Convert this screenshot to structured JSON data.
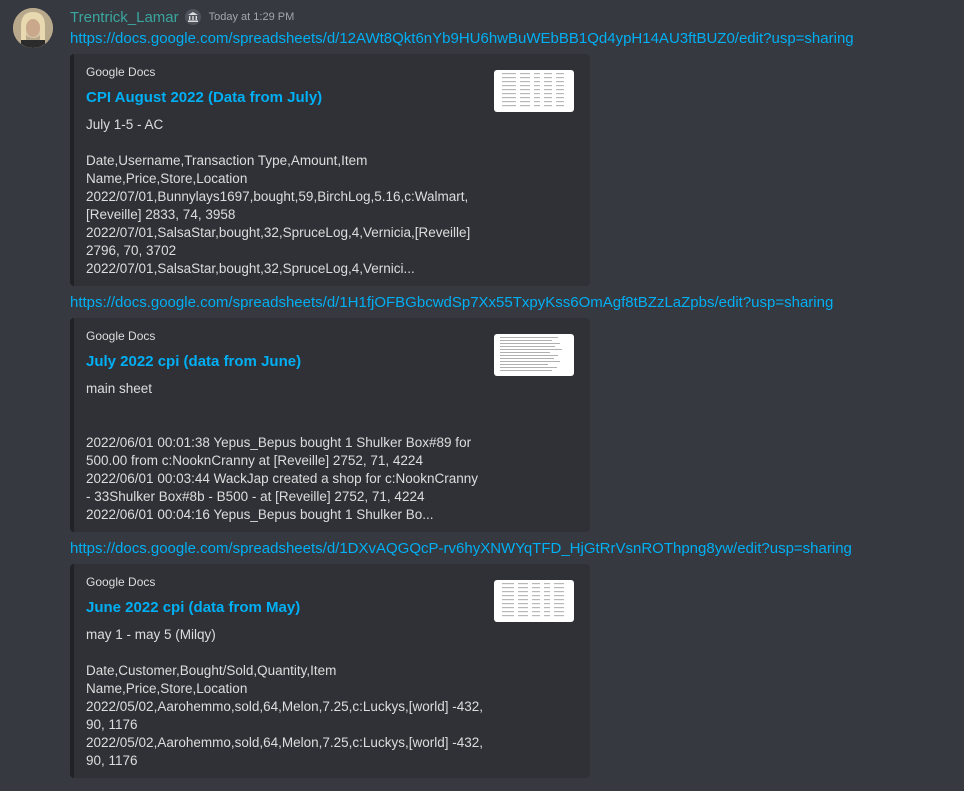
{
  "author": {
    "username": "Trentrick_Lamar",
    "badge_icon": "bank-icon",
    "timestamp": "Today at 1:29 PM"
  },
  "messages": [
    {
      "url": "https://docs.google.com/spreadsheets/d/12AWt8Qkt6nYb9HU6hwBuWEbBB1Qd4ypH14AU3ftBUZ0/edit?usp=sharing",
      "embed": {
        "provider": "Google Docs",
        "title": "CPI August 2022 (Data from July)",
        "description": "July 1-5 - AC\n\nDate,Username,Transaction Type,Amount,Item Name,Price,Store,Location\n2022/07/01,Bunnylays1697,bought,59,BirchLog,5.16,c:Walmart,[Reveille] 2833, 74, 3958\n2022/07/01,SalsaStar,bought,32,SpruceLog,4,Vernicia,[Reveille] 2796, 70, 3702\n2022/07/01,SalsaStar,bought,32,SpruceLog,4,Vernici..."
      }
    },
    {
      "url": "https://docs.google.com/spreadsheets/d/1H1fjOFBGbcwdSp7Xx55TxpyKss6OmAgf8tBZzLaZpbs/edit?usp=sharing",
      "embed": {
        "provider": "Google Docs",
        "title": "July 2022 cpi (data from June)",
        "description": "main sheet\n\n\n2022/06/01 00:01:38 Yepus_Bepus bought 1 Shulker Box#89 for 500.00 from c:NooknCranny at [Reveille] 2752, 71, 4224\n2022/06/01 00:03:44 WackJap created a shop for c:NooknCranny - 33Shulker Box#8b - B500 - at [Reveille] 2752, 71, 4224\n2022/06/01 00:04:16 Yepus_Bepus bought 1 Shulker Bo..."
      }
    },
    {
      "url": "https://docs.google.com/spreadsheets/d/1DXvAQGQcP-rv6hyXNWYqTFD_HjGtRrVsnROThpng8yw/edit?usp=sharing",
      "embed": {
        "provider": "Google Docs",
        "title": "June 2022 cpi (data from May)",
        "description": "may 1 - may 5 (Milqy)\n\nDate,Customer,Bought/Sold,Quantity,Item Name,Price,Store,Location\n2022/05/02,Aarohemmo,sold,64,Melon,7.25,c:Luckys,[world] -432, 90, 1176\n2022/05/02,Aarohemmo,sold,64,Melon,7.25,c:Luckys,[world] -432, 90, 1176"
      }
    }
  ],
  "colors": {
    "background": "#36393f",
    "embed_background": "#2f3136",
    "link": "#00aff4",
    "username": "#3aa6a0"
  }
}
